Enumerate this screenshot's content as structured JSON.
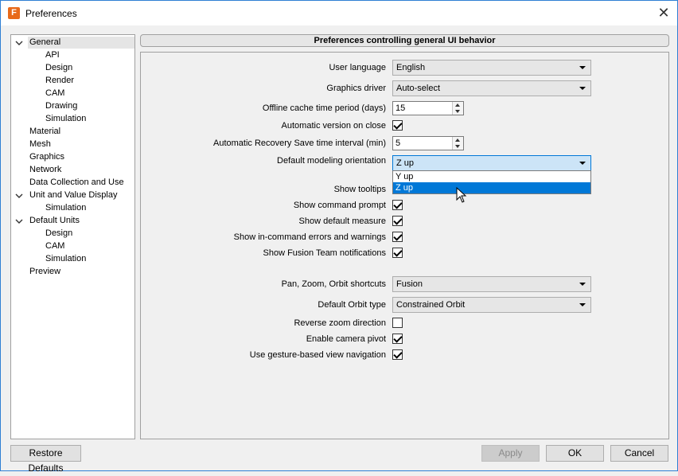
{
  "window": {
    "title": "Preferences",
    "app_icon_letter": "F",
    "close_glyph": "✕"
  },
  "tree": {
    "items": [
      {
        "label": "General",
        "level": 0,
        "expanded": true,
        "selected": true
      },
      {
        "label": "API",
        "level": 1
      },
      {
        "label": "Design",
        "level": 1
      },
      {
        "label": "Render",
        "level": 1
      },
      {
        "label": "CAM",
        "level": 1
      },
      {
        "label": "Drawing",
        "level": 1
      },
      {
        "label": "Simulation",
        "level": 1
      },
      {
        "label": "Material",
        "level": 0
      },
      {
        "label": "Mesh",
        "level": 0
      },
      {
        "label": "Graphics",
        "level": 0
      },
      {
        "label": "Network",
        "level": 0
      },
      {
        "label": "Data Collection and Use",
        "level": 0
      },
      {
        "label": "Unit and Value Display",
        "level": 0,
        "expanded": true
      },
      {
        "label": "Simulation",
        "level": 1
      },
      {
        "label": "Default Units",
        "level": 0,
        "expanded": true
      },
      {
        "label": "Design",
        "level": 1
      },
      {
        "label": "CAM",
        "level": 1
      },
      {
        "label": "Simulation",
        "level": 1
      },
      {
        "label": "Preview",
        "level": 0
      }
    ]
  },
  "panel": {
    "header": "Preferences controlling general UI behavior",
    "user_language": {
      "label": "User language",
      "value": "English"
    },
    "graphics_driver": {
      "label": "Graphics driver",
      "value": "Auto-select"
    },
    "offline_cache": {
      "label": "Offline cache time period (days)",
      "value": "15"
    },
    "auto_version": {
      "label": "Automatic version on close",
      "checked": true
    },
    "auto_recovery": {
      "label": "Automatic Recovery Save time interval (min)",
      "value": "5"
    },
    "modeling_orientation": {
      "label": "Default modeling orientation",
      "value": "Z up",
      "options": [
        "Y up",
        "Z up"
      ],
      "highlighted": "Z up"
    },
    "show_tooltips": {
      "label": "Show tooltips"
    },
    "show_command_prompt": {
      "label": "Show command prompt",
      "checked": true
    },
    "show_default_measure": {
      "label": "Show default measure",
      "checked": true
    },
    "show_errors": {
      "label": "Show in-command errors and warnings",
      "checked": true
    },
    "show_team_notifications": {
      "label": "Show Fusion Team notifications",
      "checked": true
    },
    "pan_zoom_orbit": {
      "label": "Pan, Zoom, Orbit shortcuts",
      "value": "Fusion"
    },
    "default_orbit": {
      "label": "Default Orbit type",
      "value": "Constrained Orbit"
    },
    "reverse_zoom": {
      "label": "Reverse zoom direction",
      "checked": false
    },
    "camera_pivot": {
      "label": "Enable camera pivot",
      "checked": true
    },
    "gesture_nav": {
      "label": "Use gesture-based view navigation",
      "checked": true
    }
  },
  "buttons": {
    "restore_defaults": "Restore Defaults",
    "apply": "Apply",
    "ok": "OK",
    "cancel": "Cancel"
  }
}
